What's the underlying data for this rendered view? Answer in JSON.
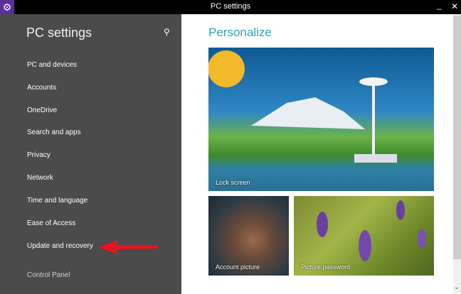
{
  "window": {
    "title": "PC settings",
    "app_icon": "gear-icon",
    "minimize": "_",
    "close": "✕"
  },
  "sidebar": {
    "title": "PC settings",
    "search_icon": "search-icon",
    "items": [
      {
        "label": "PC and devices"
      },
      {
        "label": "Accounts"
      },
      {
        "label": "OneDrive"
      },
      {
        "label": "Search and apps"
      },
      {
        "label": "Privacy"
      },
      {
        "label": "Network"
      },
      {
        "label": "Time and language"
      },
      {
        "label": "Ease of Access"
      },
      {
        "label": "Update and recovery"
      }
    ],
    "control_panel": "Control Panel"
  },
  "main": {
    "title": "Personalize",
    "tiles": [
      {
        "label": "Lock screen"
      },
      {
        "label": "Account picture"
      },
      {
        "label": "Picture password"
      }
    ]
  },
  "annotation": {
    "arrow_color": "#e8141b"
  },
  "colors": {
    "accent": "#2aa5b3",
    "sidebar": "#4b4b4b"
  }
}
